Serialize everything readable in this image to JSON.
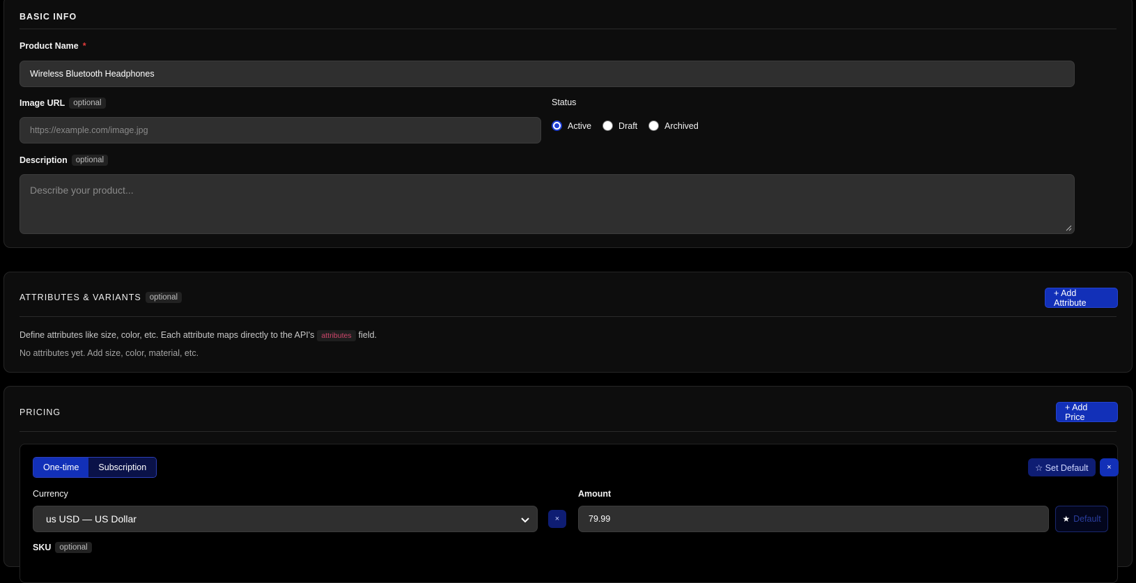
{
  "basic_info": {
    "title": "BASIC INFO",
    "product_name_label": "Product Name",
    "required_mark": "*",
    "product_name_value": "Wireless Bluetooth Headphones",
    "image_url_label": "Image URL",
    "optional_tag": "optional",
    "image_url_placeholder": "https://example.com/image.jpg",
    "status_label": "Status",
    "status_options": [
      "Active",
      "Draft",
      "Archived"
    ],
    "status_selected": "Active",
    "description_label": "Description",
    "description_placeholder": "Describe your product..."
  },
  "attributes": {
    "title": "ATTRIBUTES & VARIANTS",
    "optional_tag": "optional",
    "add_button": "+ Add Attribute",
    "help_before": "Define attributes like size, color, etc. Each attribute maps directly to the API's",
    "help_code": "attributes",
    "help_after": "field.",
    "empty_text": "No attributes yet. Add size, color, material, etc."
  },
  "pricing": {
    "title": "PRICING",
    "add_button": "+ Add Price",
    "type_options": [
      "One-time",
      "Subscription"
    ],
    "type_selected": "One-time",
    "set_default_button": "☆ Set Default",
    "remove_button": "×",
    "currency_label": "Currency",
    "currency_value": "us USD — US Dollar",
    "currency_clear": "×",
    "amount_label": "Amount",
    "amount_value": "79.99",
    "default_star": "★",
    "default_button": "Default",
    "sku_label": "SKU",
    "sku_optional": "optional"
  },
  "colors": {
    "accent": "#1230b8",
    "required": "#e23b3b",
    "code": "#d0466b"
  }
}
